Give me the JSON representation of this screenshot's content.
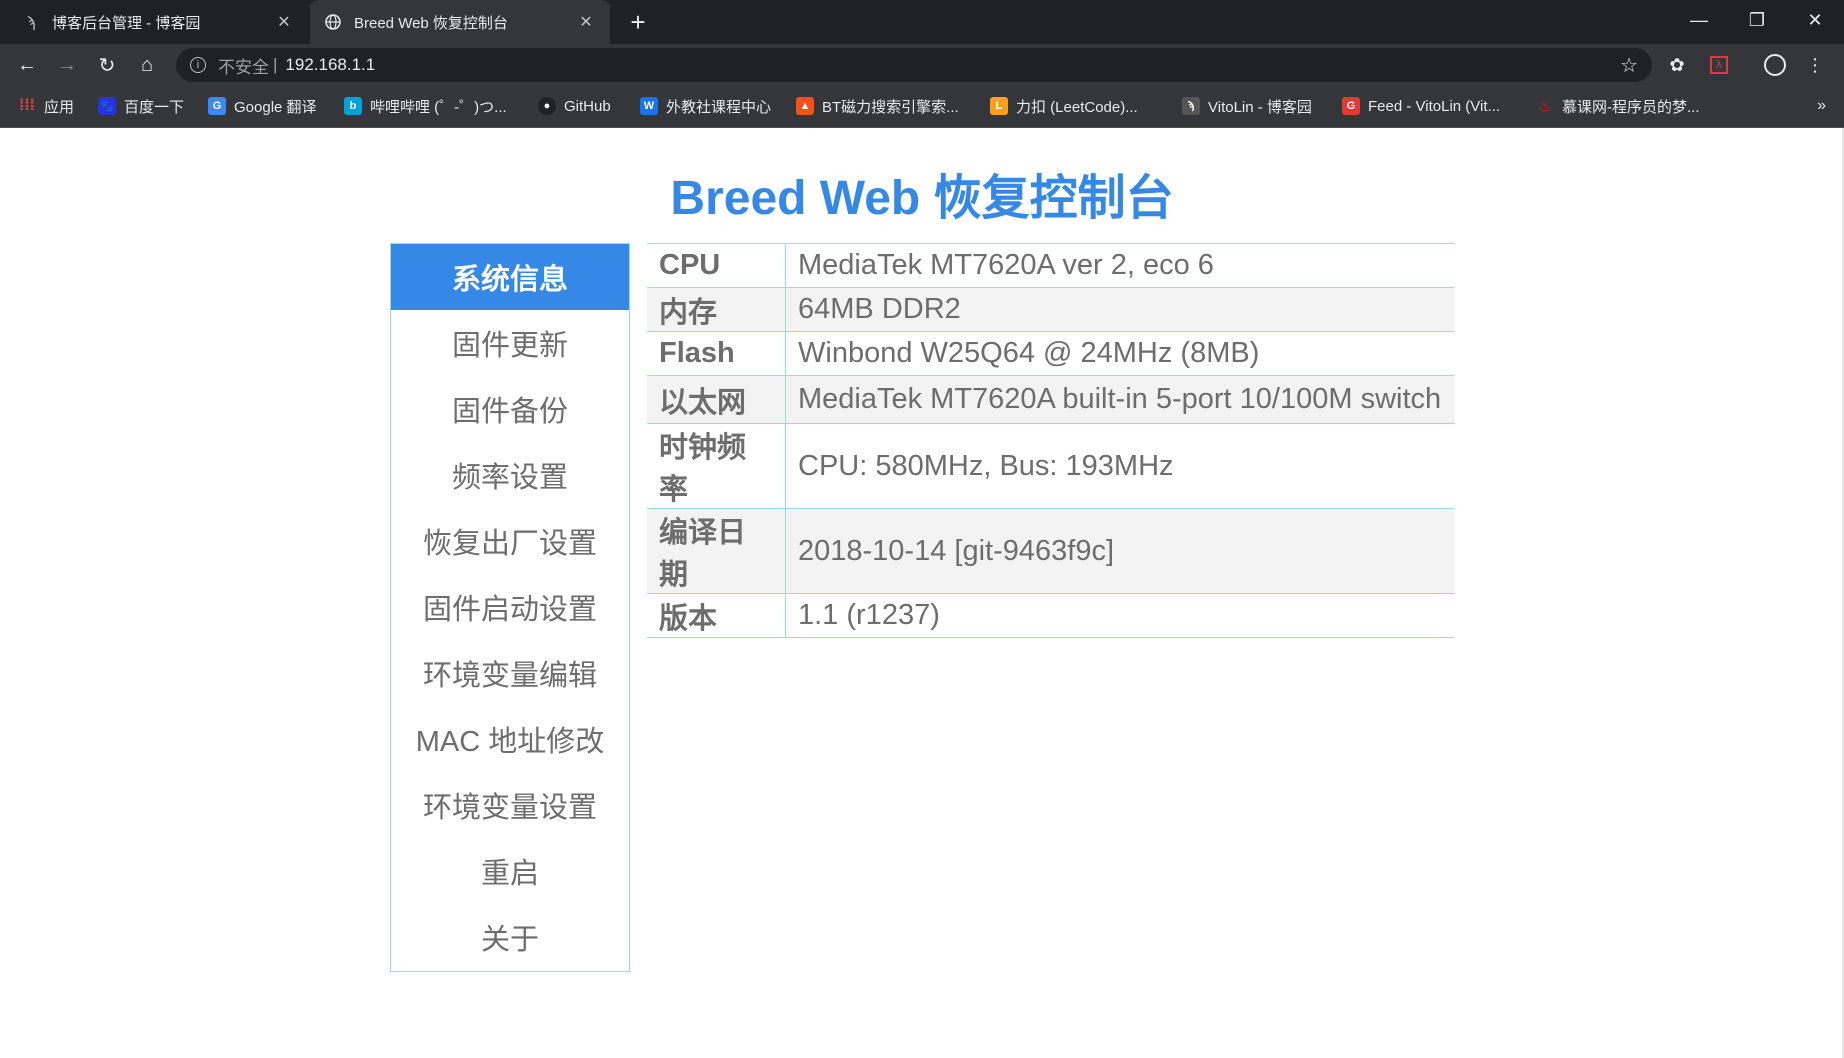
{
  "browser": {
    "tabs": [
      {
        "title": "博客后台管理 - 博客园",
        "active": false,
        "icon": "cnblogs-icon"
      },
      {
        "title": "Breed Web 恢复控制台",
        "active": true,
        "icon": "globe-icon"
      }
    ],
    "address": {
      "security_label": "不安全",
      "url": "192.168.1.1"
    },
    "bookmarks": [
      {
        "label": "应用",
        "icon": "apps-grid-icon",
        "color": "#ea4335"
      },
      {
        "label": "百度一下",
        "icon": "baidu-icon",
        "color": "#2932e1"
      },
      {
        "label": "Google 翻译",
        "icon": "google-translate-icon",
        "color": "#4285f4"
      },
      {
        "label": "哔哩哔哩 (゜-゜)つ...",
        "icon": "bilibili-icon",
        "color": "#00a1d6"
      },
      {
        "label": "GitHub",
        "icon": "github-icon",
        "color": "#202124"
      },
      {
        "label": "外教社课程中心",
        "icon": "w-icon",
        "color": "#1a73e8"
      },
      {
        "label": "BT磁力搜索引擎索...",
        "icon": "bt-icon",
        "color": "#f4511e"
      },
      {
        "label": "力扣 (LeetCode)...",
        "icon": "leetcode-icon",
        "color": "#ffa116"
      },
      {
        "label": "VitoLin - 博客园",
        "icon": "cnblogs-icon",
        "color": "#555555"
      },
      {
        "label": "Feed - VitoLin (Vit...",
        "icon": "feed-icon",
        "color": "#e53935"
      },
      {
        "label": "慕课网-程序员的梦...",
        "icon": "imooc-icon",
        "color": "#f01414"
      }
    ],
    "overflow_label": "»"
  },
  "page": {
    "title": "Breed Web 恢复控制台",
    "menu": [
      {
        "label": "系统信息",
        "active": true
      },
      {
        "label": "固件更新",
        "active": false
      },
      {
        "label": "固件备份",
        "active": false
      },
      {
        "label": "频率设置",
        "active": false
      },
      {
        "label": "恢复出厂设置",
        "active": false
      },
      {
        "label": "固件启动设置",
        "active": false
      },
      {
        "label": "环境变量编辑",
        "active": false
      },
      {
        "label": "MAC 地址修改",
        "active": false
      },
      {
        "label": "环境变量设置",
        "active": false
      },
      {
        "label": "重启",
        "active": false
      },
      {
        "label": "关于",
        "active": false
      }
    ],
    "info": [
      {
        "key": "CPU",
        "value": "MediaTek MT7620A ver 2, eco 6"
      },
      {
        "key": "内存",
        "value": "64MB DDR2"
      },
      {
        "key": "Flash",
        "value": "Winbond W25Q64 @ 24MHz (8MB)"
      },
      {
        "key": "以太网",
        "value": "MediaTek MT7620A built-in 5-port 10/100M switch"
      },
      {
        "key": "时钟频率",
        "value": "CPU: 580MHz, Bus: 193MHz"
      },
      {
        "key": "编译日期",
        "value": "2018-10-14 [git-9463f9c]"
      },
      {
        "key": "版本",
        "value": "1.1 (r1237)"
      }
    ]
  },
  "colors": {
    "accent": "#3688e6",
    "border": "#8ee1de",
    "text": "#6d6d6d",
    "row_shade": "#f3f3f3"
  }
}
